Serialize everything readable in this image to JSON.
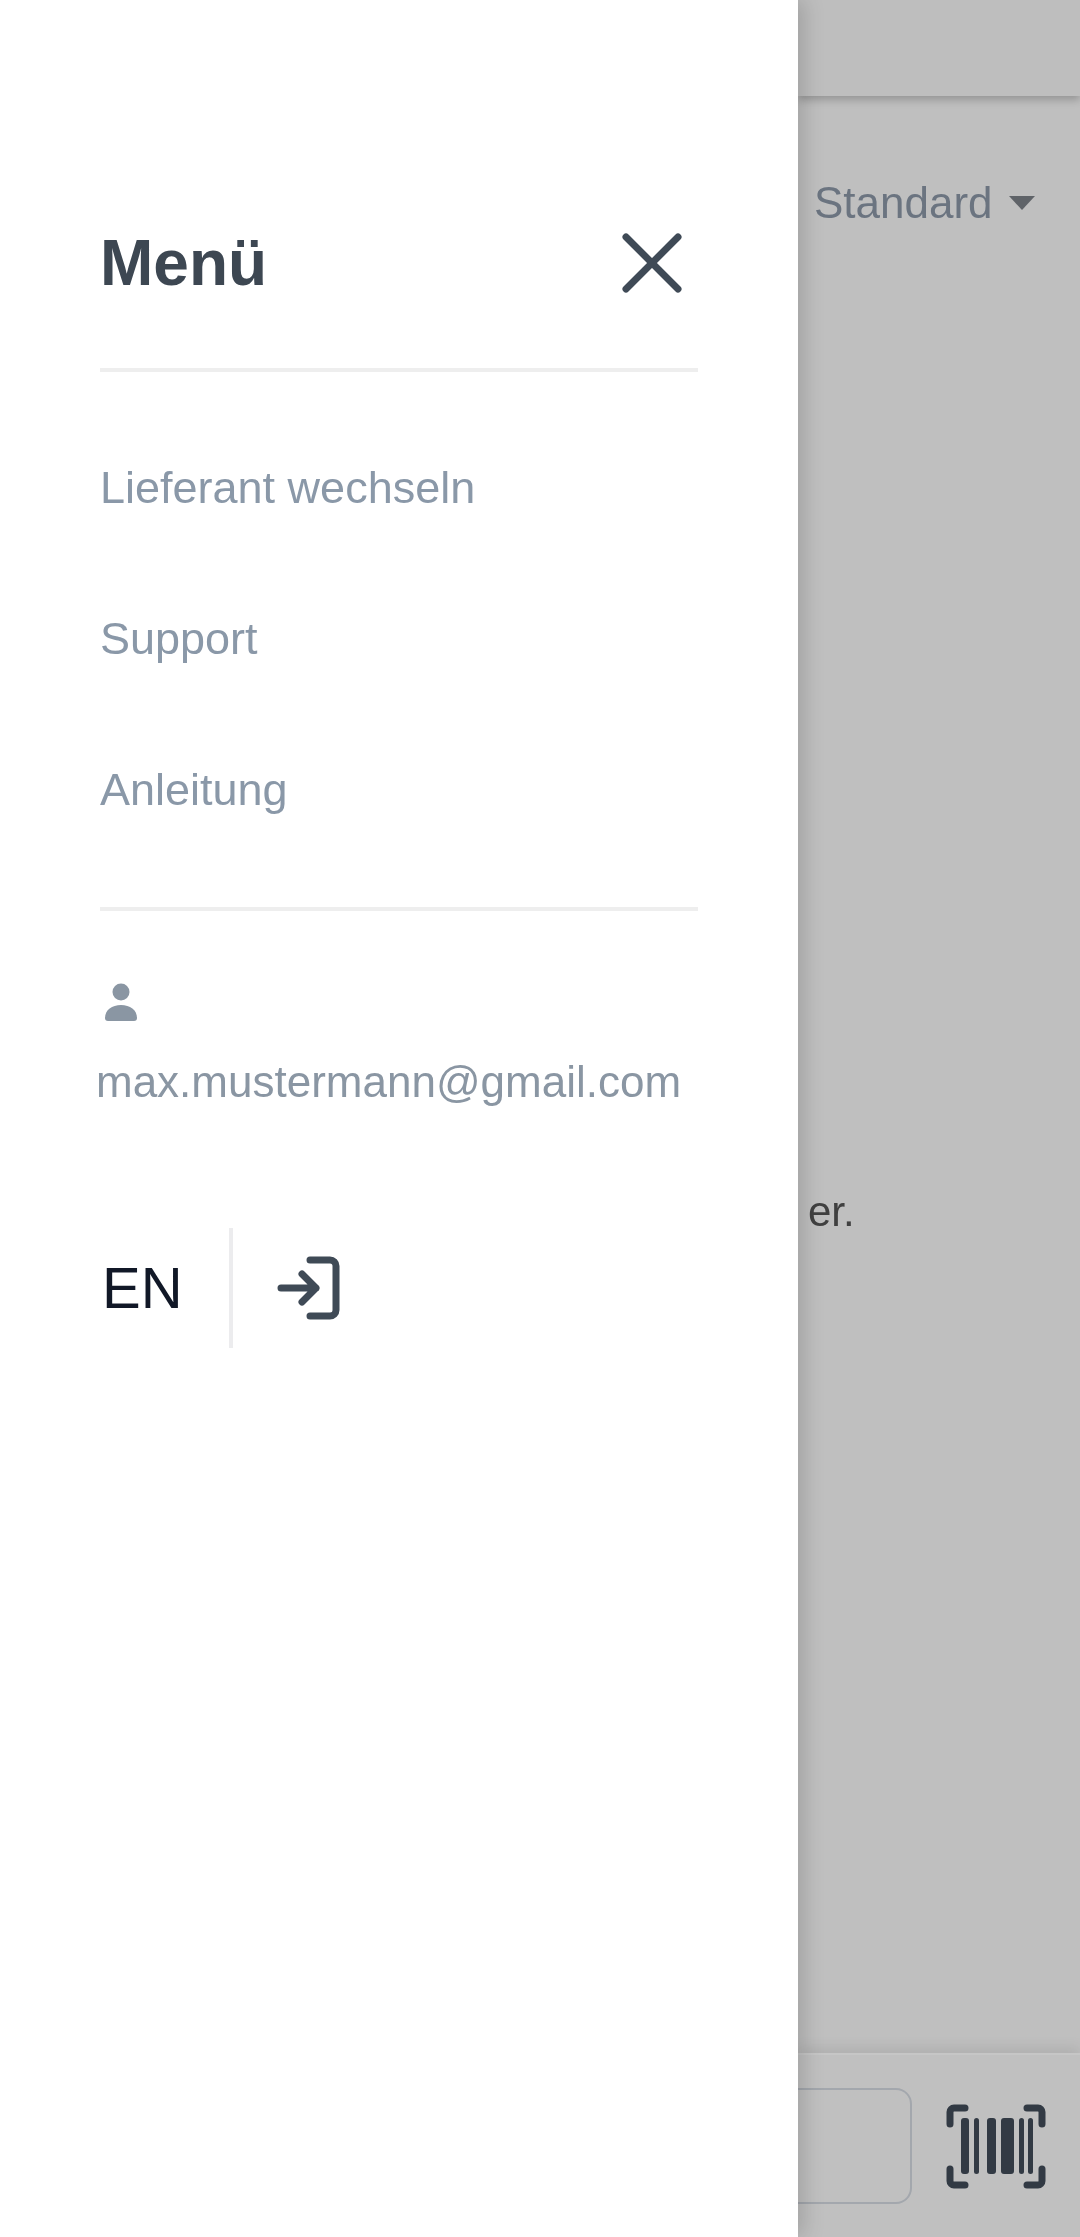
{
  "drawer": {
    "title": "Menü",
    "menu_items": [
      "Lieferant wechseln",
      "Support",
      "Anleitung"
    ],
    "user": {
      "email": "max.mustermann@gmail.com"
    },
    "language": "EN"
  },
  "background": {
    "dropdown": {
      "value": "Standard"
    },
    "text_fragment": "er."
  }
}
